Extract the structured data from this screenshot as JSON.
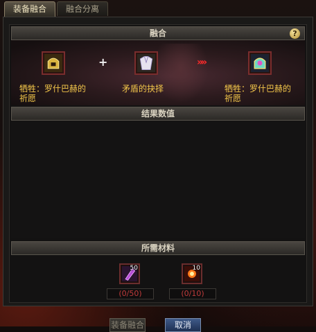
{
  "tabs": [
    {
      "label": "装备融合",
      "active": true
    },
    {
      "label": "融合分离",
      "active": false
    }
  ],
  "fusion": {
    "title": "融合",
    "help": "?",
    "plus": "+",
    "arrows": "»»",
    "items": [
      {
        "name_line1": "牺牲：罗什巴赫的",
        "name_line2": "祈愿",
        "icon": "helm-icon"
      },
      {
        "name_line1": "矛盾的抉择",
        "name_line2": "",
        "icon": "armor-icon"
      },
      {
        "name_line1": "牺牲：罗什巴赫的",
        "name_line2": "祈愿",
        "icon": "fused-helm-icon"
      }
    ]
  },
  "result": {
    "title": "结果数值"
  },
  "materials": {
    "title": "所需材料",
    "items": [
      {
        "count": "50",
        "progress": "(0/50)",
        "icon": "crystal-icon"
      },
      {
        "count": "10",
        "progress": "(0/10)",
        "icon": "sun-orb-icon"
      }
    ]
  },
  "buttons": {
    "fuse": "装备融合",
    "cancel": "取消"
  },
  "colors": {
    "item_name": "#f2c64a",
    "progress": "#c03b3b",
    "arrows": "#ff2a2a"
  }
}
